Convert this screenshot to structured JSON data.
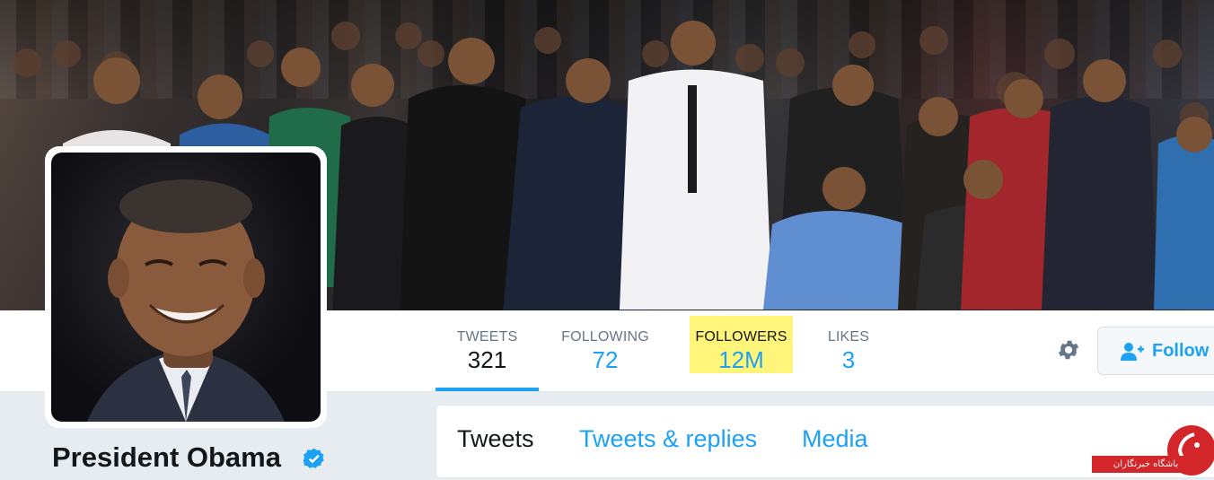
{
  "profile": {
    "name": "President Obama",
    "verified_icon": "verified-badge-icon"
  },
  "stats": [
    {
      "label": "TWEETS",
      "value": "321",
      "active": true
    },
    {
      "label": "FOLLOWING",
      "value": "72"
    },
    {
      "label": "FOLLOWERS",
      "value": "12M",
      "highlighted": true
    },
    {
      "label": "LIKES",
      "value": "3"
    }
  ],
  "actions": {
    "settings_icon": "gear-icon",
    "follow_label": "Follow",
    "follow_icon": "add-user-icon"
  },
  "timeline_tabs": [
    {
      "label": "Tweets",
      "active": true
    },
    {
      "label": "Tweets & replies"
    },
    {
      "label": "Media"
    }
  ],
  "watermark": {
    "text": "باشگاه خبرنگاران"
  },
  "colors": {
    "accent": "#1da1f2",
    "highlight": "#fff57a",
    "text_primary": "#14171a",
    "text_secondary": "#657786"
  }
}
